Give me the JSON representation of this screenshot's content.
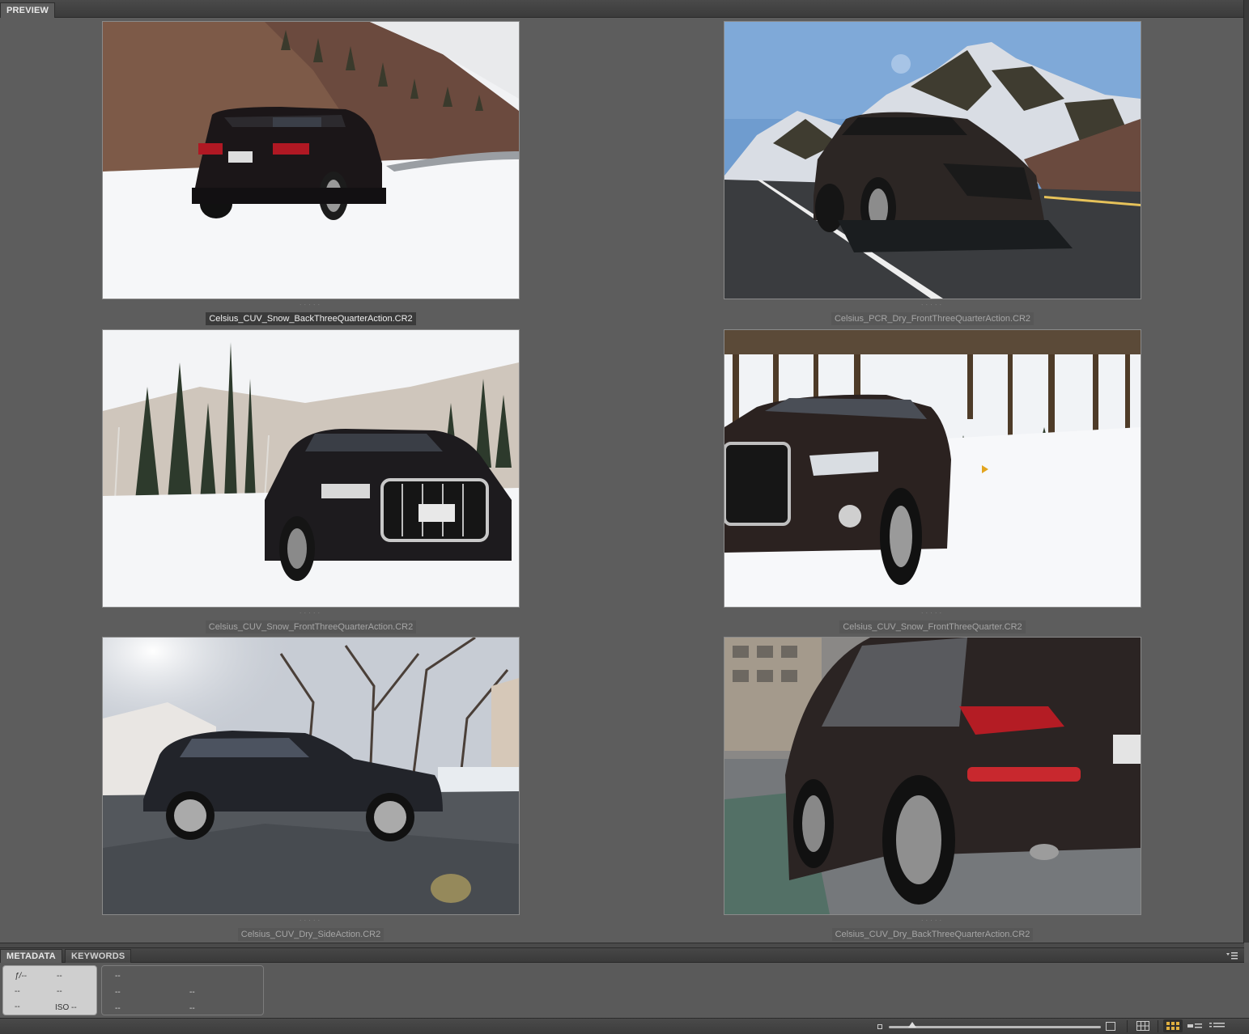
{
  "preview_panel": {
    "tab_label": "PREVIEW"
  },
  "thumbnails": [
    {
      "filename": "Celsius_CUV_Snow_BackThreeQuarterAction.CR2",
      "selected": true
    },
    {
      "filename": "Celsius_PCR_Dry_FrontThreeQuarterAction.CR2",
      "selected": false
    },
    {
      "filename": "Celsius_CUV_Snow_FrontThreeQuarterAction.CR2",
      "selected": false
    },
    {
      "filename": "Celsius_CUV_Snow_FrontThreeQuarter.CR2",
      "selected": false
    },
    {
      "filename": "Celsius_CUV_Dry_SideAction.CR2",
      "selected": false
    },
    {
      "filename": "Celsius_CUV_Dry_BackThreeQuarterAction.CR2",
      "selected": false
    }
  ],
  "bottom_panel": {
    "tabs": [
      "METADATA",
      "KEYWORDS"
    ],
    "active_tab": "METADATA",
    "panel_menu_icon": "panel-menu-icon"
  },
  "metadata": {
    "aperture": "ƒ/--",
    "shutter": "--",
    "exposure_comp": "--",
    "metering": "--",
    "white_balance": "--",
    "iso": "ISO --",
    "dimensions": "--",
    "file_size": "--",
    "resolution": "--",
    "color_mode": "--",
    "color_profile": "--"
  },
  "status_bar": {
    "thumbnail_size_value": 0.11,
    "icons": [
      "small-thumb-icon",
      "large-thumb-icon",
      "lock-grid-icon",
      "thumbnail-view-icon",
      "details-view-icon",
      "list-view-icon"
    ],
    "active_view": "thumbnail-view"
  }
}
